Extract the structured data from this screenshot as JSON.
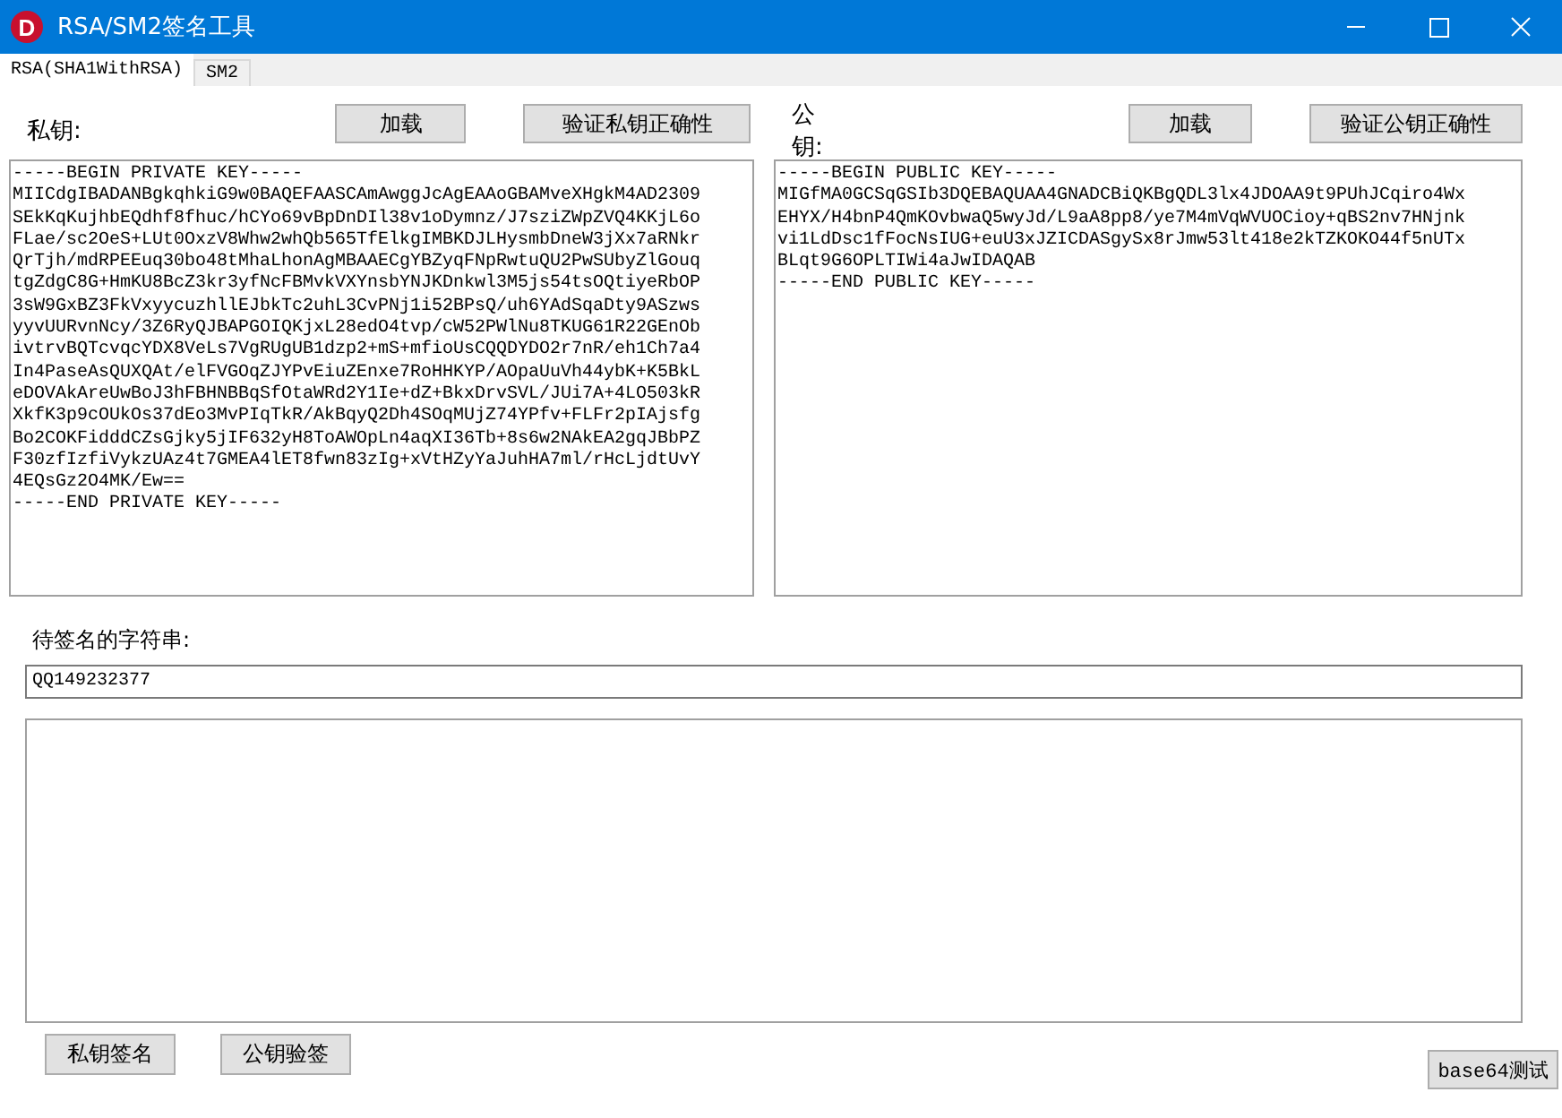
{
  "window": {
    "title": "RSA/SM2签名工具",
    "icon_letter": "D"
  },
  "tabs": [
    {
      "label": "RSA(SHA1WithRSA)",
      "selected": true
    },
    {
      "label": "SM2",
      "selected": false
    }
  ],
  "private_key": {
    "label": "私钥:",
    "buttons": [
      "加载",
      "验证私钥正确性"
    ],
    "value": "-----BEGIN PRIVATE KEY-----\nMIICdgIBADANBgkqhkiG9w0BAQEFAASCAmAwggJcAgEAAoGBAMveXHgkM4AD2309\nSEkKqKujhbEQdhf8fhuc/hCYo69vBpDnDIl38v1oDymnz/J7sziZWpZVQ4KKjL6o\nFLae/sc2OeS+LUt0OxzV8Whw2whQb565TfElkgIMBKDJLHysmbDneW3jXx7aRNkr\nQrTjh/mdRPEEuq30bo48tMhaLhonAgMBAAECgYBZyqFNpRwtuQU2PwSUbyZlGouq\ntgZdgC8G+HmKU8BcZ3kr3yfNcFBMvkVXYnsbYNJKDnkwl3M5js54tsOQtiyeRbOP\n3sW9GxBZ3FkVxyycuzhllEJbkTc2uhL3CvPNj1i52BPsQ/uh6YAdSqaDty9ASzws\nyyvUURvnNcy/3Z6RyQJBAPGOIQKjxL28edO4tvp/cW52PWlNu8TKUG61R22GEnOb\nivtrvBQTcvqcYDX8VeLs7VgRUgUB1dzp2+mS+mfioUsCQQDYDO2r7nR/eh1Ch7a4\nIn4PaseAsQUXQAt/elFVGOqZJYPvEiuZEnxe7RoHHKYP/AOpaUuVh44ybK+K5BkL\neDOVAkAreUwBoJ3hFBHNBBqSfOtaWRd2Y1Ie+dZ+BkxDrvSVL/JUi7A+4LO503kR\nXkfK3p9cOUkOs37dEo3MvPIqTkR/AkBqyQ2Dh4SOqMUjZ74YPfv+FLFr2pIAjsfg\nBo2COKFidddCZsGjky5jIF632yH8ToAWOpLn4aqXI36Tb+8s6w2NAkEA2gqJBbPZ\nF30zfIzfiVykzUAz4t7GMEA4lET8fwn83zIg+xVtHZyYaJuhHA7ml/rHcLjdtUvY\n4EQsGz2O4MK/Ew==\n-----END PRIVATE KEY-----"
  },
  "public_key": {
    "label": "公钥:",
    "buttons": [
      "加载",
      "验证公钥正确性"
    ],
    "value": "-----BEGIN PUBLIC KEY-----\nMIGfMA0GCSqGSIb3DQEBAQUAA4GNADCBiQKBgQDL3lx4JDOAA9t9PUhJCqiro4Wx\nEHYX/H4bnP4QmKOvbwaQ5wyJd/L9aA8pp8/ye7M4mVqWVUOCioy+qBS2nv7HNjnk\nvi1LdDsc1fFocNsIUG+euU3xJZICDASgySx8rJmw53lt418e2kTZKOKO44f5nUTx\nBLqt9G6OPLTIWi4aJwIDAQAB\n-----END PUBLIC KEY-----"
  },
  "input": {
    "label": "待签名的字符串:",
    "value": "QQ149232377"
  },
  "buttons": [
    "私钥签名",
    "公钥验签"
  ],
  "test_button": "base64测试"
}
